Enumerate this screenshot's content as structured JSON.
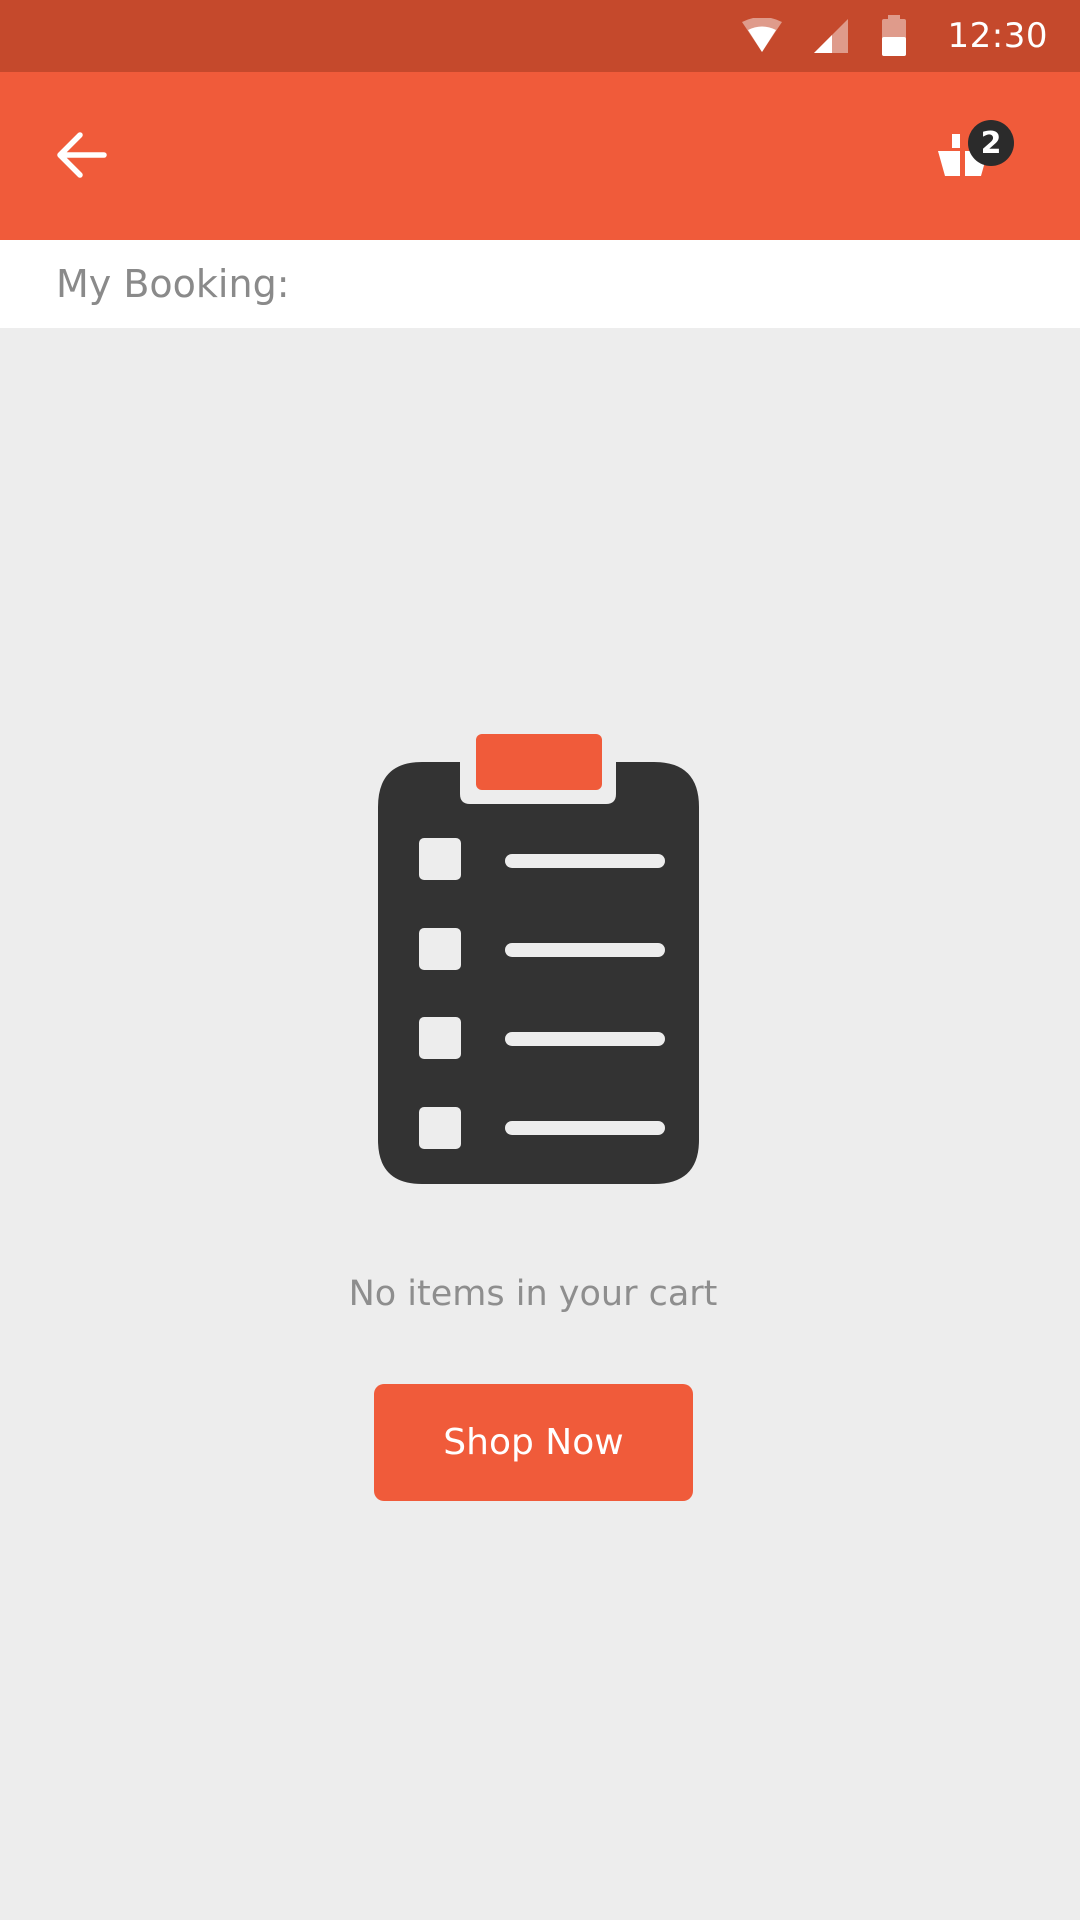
{
  "status_bar": {
    "time": "12:30",
    "icons": [
      "wifi-icon",
      "cellular-signal-icon",
      "battery-icon"
    ]
  },
  "app_bar": {
    "back_icon": "arrow-left-icon",
    "cart_icon": "shopping-basket-icon",
    "cart_count": "2"
  },
  "header": {
    "title": "My Booking:"
  },
  "empty_state": {
    "illustration": "clipboard-checklist-icon",
    "message": "No items in your cart",
    "button_label": "Shop Now"
  },
  "colors": {
    "status_bar": "#c5492c",
    "accent": "#f05b3a",
    "background": "#ededed",
    "icon_dark": "#333333",
    "text_muted": "#8a8a8a"
  }
}
